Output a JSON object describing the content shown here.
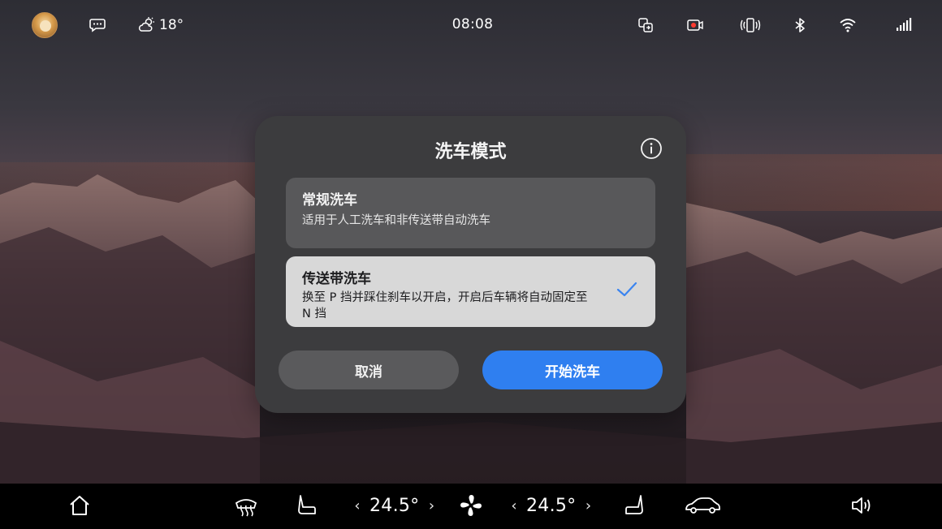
{
  "status_bar": {
    "avatar_icon": "user-avatar",
    "message_icon": "chat-bubble-icon",
    "weather_icon": "partly-cloudy-icon",
    "temperature": "18°",
    "time": "08:08",
    "right_icons": [
      "screen-mirror-icon",
      "dashcam-recording-icon",
      "vibrate-icon",
      "bluetooth-icon",
      "wifi-icon",
      "signal-icon"
    ]
  },
  "dialog": {
    "title": "洗车模式",
    "info_icon": "info-icon",
    "options": [
      {
        "title": "常规洗车",
        "description": "适用于人工洗车和非传送带自动洗车",
        "selected": false
      },
      {
        "title": "传送带洗车",
        "description": "换至 P 挡并踩住刹车以开启，开启后车辆将自动固定至 N 挡",
        "selected": true
      }
    ],
    "cancel_label": "取消",
    "confirm_label": "开始洗车",
    "accent_color": "#2f7ff0"
  },
  "dock": {
    "home_icon": "home-icon",
    "defrost_icon": "rear-defrost-icon",
    "left_seat_icon": "seat-heat-left-icon",
    "left_temp": "24.5°",
    "fan_icon": "fan-icon",
    "right_temp": "24.5°",
    "right_seat_icon": "seat-heat-right-icon",
    "car_icon": "car-icon",
    "volume_icon": "volume-icon",
    "chevron_left": "‹",
    "chevron_right": "›"
  }
}
